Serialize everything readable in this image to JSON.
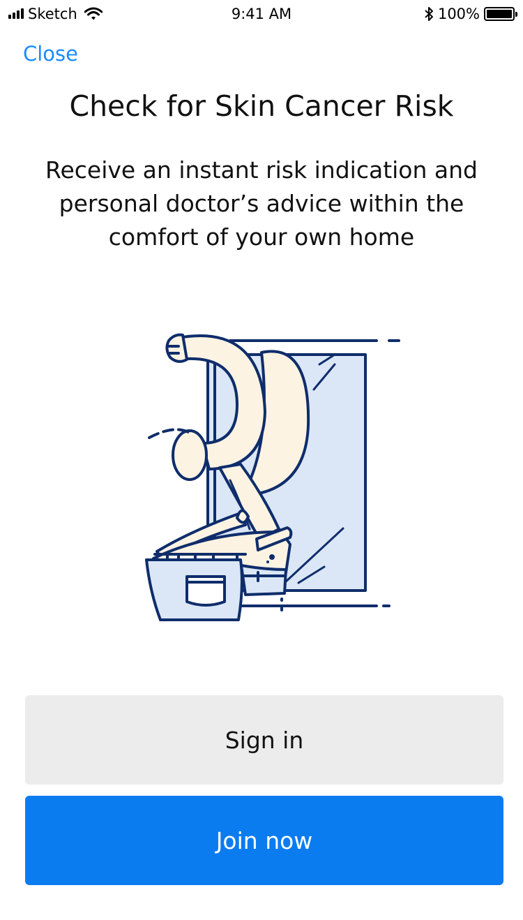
{
  "status_bar": {
    "carrier": "Sketch",
    "time": "9:41 AM",
    "battery": "100%",
    "icons": [
      "signal-icon",
      "wifi-icon",
      "bluetooth-icon",
      "battery-icon"
    ]
  },
  "nav": {
    "close_label": "Close"
  },
  "main": {
    "title": "Check for Skin Cancer Risk",
    "subtitle": "Receive an instant risk indication and personal doctor’s advice within the comfort of your own home"
  },
  "actions": {
    "signin_label": "Sign in",
    "join_label": "Join now"
  },
  "colors": {
    "accent": "#1a8cff",
    "primary_button": "#0a7cf0",
    "secondary_button": "#ececec",
    "illustration_outline": "#0f2d6b",
    "skin": "#fdf3e3",
    "window_blue": "#dbe7f6"
  }
}
